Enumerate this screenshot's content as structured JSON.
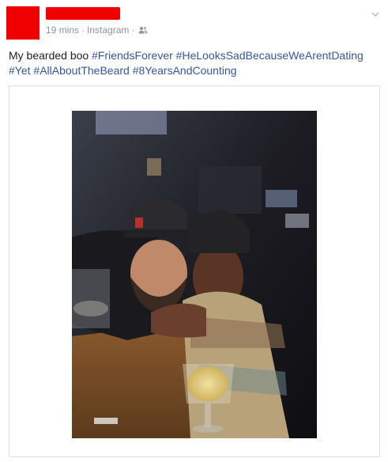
{
  "post": {
    "meta": {
      "time": "19 mins",
      "separator": "·",
      "source": "Instagram",
      "separator2": "·",
      "audience_icon": "friends-icon"
    },
    "text": {
      "plain": "My bearded boo ",
      "hashtags": [
        "#FriendsForever",
        "#HeLooksSadBecauseWeArentDating",
        "#Yet",
        "#AllAboutTheBeard",
        "#8YearsAndCounting"
      ]
    },
    "menu_icon": "chevron-down-icon",
    "colors": {
      "redaction": "#f00000",
      "link": "#365899",
      "meta": "#90949c",
      "text": "#1d2129"
    }
  }
}
